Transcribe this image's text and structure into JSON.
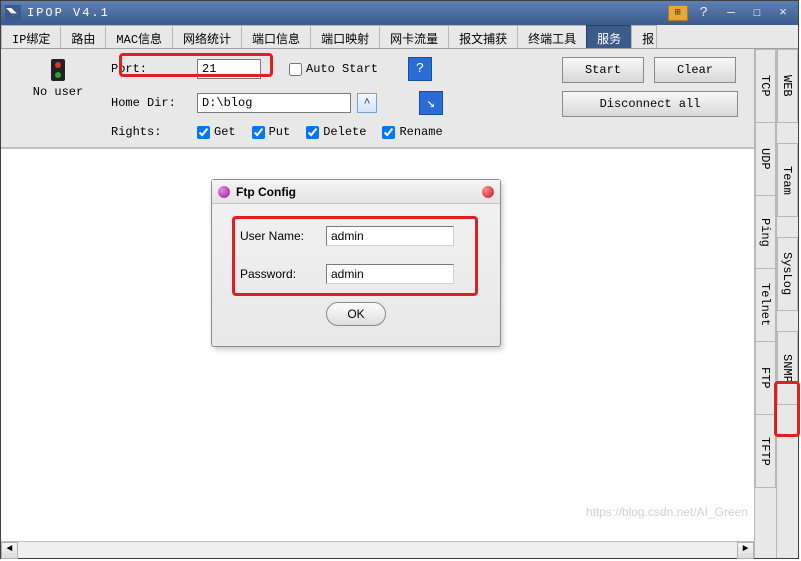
{
  "titlebar": {
    "title": "IPOP V4.1",
    "help_symbol": "?",
    "min_symbol": "—",
    "max_symbol": "☐",
    "close_symbol": "×"
  },
  "tabs": {
    "items": [
      {
        "label": "IP绑定"
      },
      {
        "label": "路由"
      },
      {
        "label": "MAC信息"
      },
      {
        "label": "网络统计"
      },
      {
        "label": "端口信息"
      },
      {
        "label": "端口映射"
      },
      {
        "label": "网卡流量"
      },
      {
        "label": "报文捕获"
      },
      {
        "label": "终端工具"
      },
      {
        "label": "服务",
        "active": true
      },
      {
        "label": "报",
        "partial": true
      }
    ]
  },
  "status": {
    "no_user": "No user"
  },
  "form": {
    "port_label": "Port:",
    "port_value": "21",
    "home_label": "Home Dir:",
    "home_value": "D:\\blog",
    "rights_label": "Rights:",
    "auto_start_label": "Auto Start",
    "get_label": "Get",
    "put_label": "Put",
    "delete_label": "Delete",
    "rename_label": "Rename",
    "checks": {
      "auto_start": false,
      "get": true,
      "put": true,
      "delete": true,
      "rename": true
    }
  },
  "buttons": {
    "start": "Start",
    "clear": "Clear",
    "disconnect": "Disconnect all",
    "help_icon": "?",
    "down_icon": "↘",
    "dropdown_icon": "˄"
  },
  "dialog": {
    "title": "Ftp Config",
    "user_label": "User Name:",
    "user_value": "admin",
    "pass_label": "Password:",
    "pass_value": "admin",
    "ok": "OK"
  },
  "side_tabs_inner": [
    "TCP",
    "UDP",
    "Ping",
    "Telnet",
    "FTP",
    "TFTP"
  ],
  "side_tabs_outer": [
    "WEB",
    "",
    "Team",
    "",
    "SysLog",
    "",
    "SNMP"
  ],
  "scrollbar": {
    "left": "◄",
    "right": "►"
  },
  "watermark": "https://blog.csdn.net/AI_Green"
}
